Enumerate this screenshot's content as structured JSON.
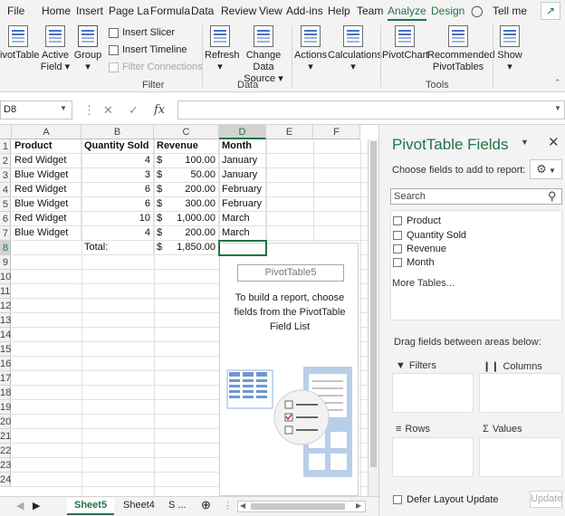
{
  "ribbon_tabs": [
    "File",
    "Home",
    "Insert",
    "Page La",
    "Formula",
    "Data",
    "Review",
    "View",
    "Add-ins",
    "Help",
    "Team",
    "Analyze",
    "Design",
    "Tell me"
  ],
  "ribbon": {
    "pivottable": "ivotTable",
    "active_field_1": "Active",
    "active_field_2": "Field",
    "group": "Group",
    "insert_slicer": "Insert Slicer",
    "insert_timeline": "Insert Timeline",
    "filter_connections": "Filter Connections",
    "filter_group": "Filter",
    "refresh": "Refresh",
    "change_source_1": "Change Data",
    "change_source_2": "Source",
    "data_group": "Data",
    "actions": "Actions",
    "calculations": "Calculations",
    "pivotchart": "PivotChart",
    "recommended_1": "Recommended",
    "recommended_2": "PivotTables",
    "tools_group": "Tools",
    "show": "Show"
  },
  "formula_bar": {
    "name_box": "D8",
    "fx": "fx",
    "formula": ""
  },
  "columns": [
    "A",
    "B",
    "C",
    "D",
    "E",
    "F"
  ],
  "rows": [
    "1",
    "2",
    "3",
    "4",
    "5",
    "6",
    "7",
    "8",
    "9",
    "10",
    "11",
    "12",
    "13",
    "14",
    "15",
    "16",
    "17",
    "18",
    "19",
    "20",
    "21",
    "22",
    "23",
    "24"
  ],
  "header_row": {
    "product": "Product",
    "quantity": "Quantity Sold",
    "revenue": "Revenue",
    "month": "Month"
  },
  "data_rows": [
    {
      "product": "Red Widget",
      "quantity": "4",
      "cur": "$",
      "revenue": "100.00",
      "month": "January"
    },
    {
      "product": "Blue Widget",
      "quantity": "3",
      "cur": "$",
      "revenue": "50.00",
      "month": "January"
    },
    {
      "product": "Red Widget",
      "quantity": "6",
      "cur": "$",
      "revenue": "200.00",
      "month": "February"
    },
    {
      "product": "Blue Widget",
      "quantity": "6",
      "cur": "$",
      "revenue": "300.00",
      "month": "February"
    },
    {
      "product": "Red Widget",
      "quantity": "10",
      "cur": "$",
      "revenue": "1,000.00",
      "month": "March"
    },
    {
      "product": "Blue Widget",
      "quantity": "4",
      "cur": "$",
      "revenue": "200.00",
      "month": "March"
    }
  ],
  "total_row": {
    "label": "Total:",
    "cur": "$",
    "revenue": "1,850.00"
  },
  "placeholder": {
    "name": "PivotTable5",
    "text": "To build a report, choose fields from the PivotTable Field List"
  },
  "sheet_tabs": [
    "Sheet5",
    "Sheet4",
    "S ..."
  ],
  "pane": {
    "title": "PivotTable Fields",
    "choose": "Choose fields to add to report:",
    "search_placeholder": "Search",
    "fields": [
      "Product",
      "Quantity Sold",
      "Revenue",
      "Month"
    ],
    "more_tables": "More Tables...",
    "drag": "Drag fields between areas below:",
    "filters": "Filters",
    "columns": "Columns",
    "rows": "Rows",
    "values": "Values",
    "defer": "Defer Layout Update",
    "update": "Update"
  }
}
